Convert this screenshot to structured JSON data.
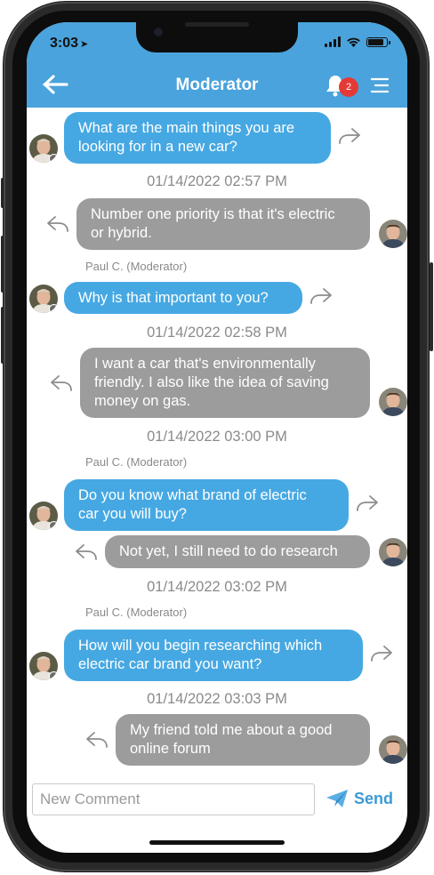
{
  "status_bar": {
    "time": "3:03",
    "location_icon": "location-arrow-icon",
    "signal_icon": "cellular-signal-icon",
    "wifi_icon": "wifi-icon",
    "battery_icon": "battery-icon",
    "battery_level": 0.9
  },
  "header": {
    "title": "Moderator",
    "back_icon": "back-arrow-icon",
    "bell_icon": "bell-icon",
    "notification_count": "2",
    "menu_icon": "menu-icon"
  },
  "colors": {
    "header_blue": "#4aa3dc",
    "moderator_bubble": "#46a8e2",
    "participant_bubble": "#9c9c9c",
    "badge_red": "#e53935",
    "send_blue": "#3c9ad6"
  },
  "messages": [
    {
      "role": "moderator",
      "text": "What are the main things you are\nlooking for in a new car?"
    },
    {
      "role": "timestamp",
      "text": "01/14/2022 02:57 PM"
    },
    {
      "role": "participant",
      "text": "Number one priority is that it's electric\nor hybrid."
    },
    {
      "role": "sender",
      "text": "Paul C. (Moderator)"
    },
    {
      "role": "moderator",
      "text": "Why is that important to you?"
    },
    {
      "role": "timestamp",
      "text": "01/14/2022 02:58 PM"
    },
    {
      "role": "participant",
      "text": "I want a car that's environmentally\nfriendly.  I also like the idea of saving\nmoney on gas."
    },
    {
      "role": "timestamp",
      "text": "01/14/2022 03:00 PM"
    },
    {
      "role": "sender",
      "text": "Paul C. (Moderator)"
    },
    {
      "role": "moderator",
      "text": "Do you know what brand of electric\ncar you will buy?"
    },
    {
      "role": "participant",
      "text": "Not yet, I still need to do research"
    },
    {
      "role": "timestamp",
      "text": "01/14/2022 03:02 PM"
    },
    {
      "role": "sender",
      "text": "Paul C. (Moderator)"
    },
    {
      "role": "moderator",
      "text": "How will you begin researching which\nelectric car brand you want?"
    },
    {
      "role": "timestamp",
      "text": "01/14/2022 03:03 PM"
    },
    {
      "role": "participant",
      "text": "My friend told me about a good\nonline forum"
    }
  ],
  "composer": {
    "placeholder": "New Comment",
    "value": "",
    "send_label": "Send",
    "send_icon": "paper-plane-icon"
  },
  "icons": {
    "reply": "reply-arrow-icon",
    "avatar": "avatar"
  }
}
